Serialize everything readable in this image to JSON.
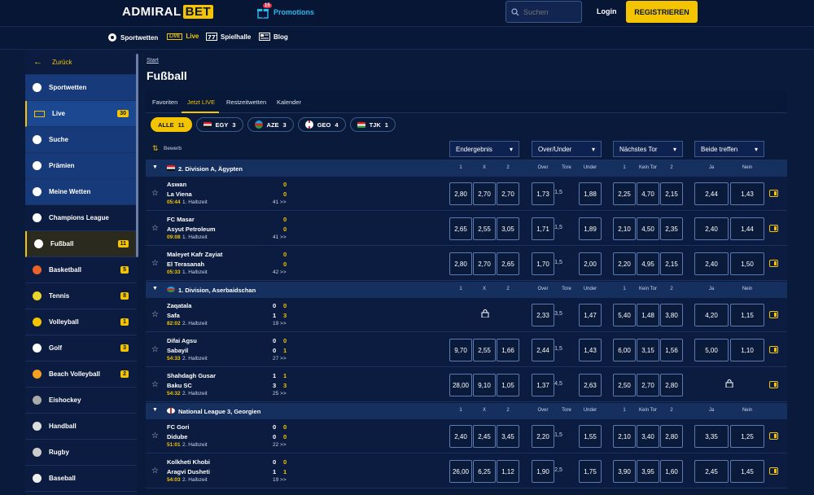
{
  "brand": {
    "logo_a": "ADMIRAL",
    "logo_b": "BET",
    "promo_count": "15",
    "promo_label": "Promotions"
  },
  "header": {
    "search_placeholder": "Suchen",
    "login": "Login",
    "register": "REGISTRIEREN"
  },
  "nav": {
    "sports": "Sportwetten",
    "live_box": "LIVE",
    "live": "Live",
    "casino": "Spielhalle",
    "blog": "Blog"
  },
  "sidebar": {
    "back": "Zurück",
    "items": [
      {
        "label": "Sportwetten",
        "icon": "sport-ball-icon"
      },
      {
        "label": "Live",
        "count": "30",
        "icon": "live-icon"
      },
      {
        "label": "Suche",
        "icon": "search-icon"
      },
      {
        "label": "Prämien",
        "icon": "rocket-icon"
      },
      {
        "label": "Meine Wetten",
        "icon": "bets-icon"
      },
      {
        "label": "Champions League",
        "icon": "trophy-icon"
      },
      {
        "label": "Fußball",
        "count": "11",
        "icon": "soccer-ball-icon"
      },
      {
        "label": "Basketball",
        "count": "5",
        "icon": "basketball-icon"
      },
      {
        "label": "Tennis",
        "count": "8",
        "icon": "tennis-ball-icon"
      },
      {
        "label": "Volleyball",
        "count": "1",
        "icon": "volleyball-icon"
      },
      {
        "label": "Golf",
        "count": "3",
        "icon": "golf-icon"
      },
      {
        "label": "Beach Volleyball",
        "count": "2",
        "icon": "beach-volleyball-icon"
      },
      {
        "label": "Eishockey",
        "icon": "puck-icon"
      },
      {
        "label": "Handball",
        "icon": "handball-icon"
      },
      {
        "label": "Rugby",
        "icon": "rugby-ball-icon"
      },
      {
        "label": "Baseball",
        "icon": "baseball-icon"
      }
    ]
  },
  "page": {
    "crumb": "Start",
    "title": "Fußball"
  },
  "tabs": [
    "Favoriten",
    "Jetzt LIVE",
    "Restzeitwetten",
    "Kalender"
  ],
  "chips": [
    {
      "label": "ALLE",
      "count": "11"
    },
    {
      "label": "EGY",
      "count": "3"
    },
    {
      "label": "AZE",
      "count": "3"
    },
    {
      "label": "GEO",
      "count": "4"
    },
    {
      "label": "TJK",
      "count": "1"
    }
  ],
  "markets": {
    "sort": "Bewerb",
    "m1": "Endergebnis",
    "m2": "Over/Under",
    "m3": "Nächstes Tor",
    "m4": "Beide treffen"
  },
  "subheads": {
    "one": "1",
    "x": "X",
    "two": "2",
    "over": "Over",
    "goals": "Tore",
    "under": "Under",
    "nogoal": "Kein Tor",
    "yes": "Ja",
    "no": "Nein"
  },
  "leagues": [
    {
      "name": "2. Division A, Ägypten",
      "matches": [
        {
          "home": "Aswan",
          "away": "La Viena",
          "hs": "0",
          "as": "0",
          "minute": "05:44",
          "half": "1. Halbzeit",
          "more": "41 >>",
          "odds": [
            "2,80",
            "2,70",
            "2,70",
            "1,73",
            "1,5",
            "1,88",
            "2,25",
            "4,70",
            "2,15",
            "2,44",
            "1,43"
          ]
        },
        {
          "home": "FC Masar",
          "away": "Asyut Petroleum",
          "hs": "0",
          "as": "0",
          "minute": "09:08",
          "half": "1. Halbzeit",
          "more": "41 >>",
          "odds": [
            "2,65",
            "2,55",
            "3,05",
            "1,71",
            "1,5",
            "1,89",
            "2,10",
            "4,50",
            "2,35",
            "2,40",
            "1,44"
          ]
        },
        {
          "home": "Maleyet Kafr Zayiat",
          "away": "El Terasanah",
          "hs": "0",
          "as": "0",
          "minute": "05:33",
          "half": "1. Halbzeit",
          "more": "42 >>",
          "odds": [
            "2,80",
            "2,70",
            "2,65",
            "1,70",
            "1,5",
            "2,00",
            "2,20",
            "4,95",
            "2,15",
            "2,40",
            "1,50"
          ]
        }
      ]
    },
    {
      "name": "1. Division, Aserbaidschan",
      "matches": [
        {
          "home": "Zaqatala",
          "away": "Safa",
          "hs1": "0",
          "as1": "1",
          "hs": "0",
          "as": "3",
          "minute": "82:02",
          "half": "2. Halbzeit",
          "more": "19 >>",
          "odds": [
            "",
            "",
            "",
            "2,33",
            "3,5",
            "1,47",
            "5,40",
            "1,48",
            "3,80",
            "4,20",
            "1,15"
          ]
        },
        {
          "home": "Difai Agsu",
          "away": "Sabayil",
          "hs1": "0",
          "as1": "0",
          "hs": "0",
          "as": "1",
          "minute": "54:33",
          "half": "2. Halbzeit",
          "more": "27 >>",
          "odds": [
            "9,70",
            "2,55",
            "1,66",
            "2,44",
            "1,5",
            "1,43",
            "6,00",
            "3,15",
            "1,56",
            "5,00",
            "1,10"
          ]
        },
        {
          "home": "Shahdagh Gusar",
          "away": "Baku SC",
          "hs1": "1",
          "as1": "3",
          "hs": "1",
          "as": "3",
          "minute": "54:32",
          "half": "2. Halbzeit",
          "more": "25 >>",
          "odds": [
            "28,00",
            "9,10",
            "1,05",
            "1,37",
            "4,5",
            "2,63",
            "2,50",
            "2,70",
            "2,80",
            "",
            ""
          ]
        }
      ]
    },
    {
      "name": "National League 3, Georgien",
      "matches": [
        {
          "home": "FC Gori",
          "away": "Didube",
          "hs1": "0",
          "as1": "0",
          "hs": "0",
          "as": "0",
          "minute": "51:01",
          "half": "2. Halbzeit",
          "more": "22 >>",
          "odds": [
            "2,40",
            "2,45",
            "3,45",
            "2,20",
            "1,5",
            "1,55",
            "2,10",
            "3,40",
            "2,80",
            "3,35",
            "1,25"
          ]
        },
        {
          "home": "Kolkheti Khobi",
          "away": "Aragvi Dusheti",
          "hs1": "0",
          "as1": "1",
          "hs": "0",
          "as": "1",
          "minute": "54:03",
          "half": "2. Halbzeit",
          "more": "19 >>",
          "odds": [
            "26,00",
            "6,25",
            "1,12",
            "1,90",
            "2,5",
            "1,75",
            "3,90",
            "3,95",
            "1,60",
            "2,45",
            "1,45"
          ]
        }
      ]
    }
  ]
}
